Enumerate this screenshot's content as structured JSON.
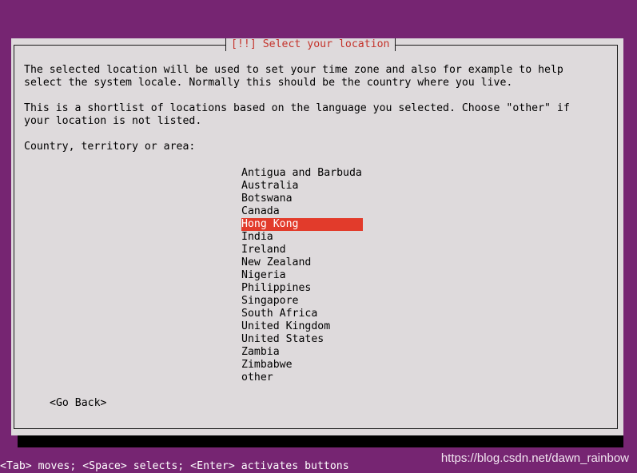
{
  "dialog": {
    "title": "[!!] Select your location",
    "paragraph1_line1": "The selected location will be used to set your time zone and also for example to help",
    "paragraph1_line2": "select the system locale. Normally this should be the country where you live.",
    "paragraph2_line1": "This is a shortlist of locations based on the language you selected. Choose \"other\" if",
    "paragraph2_line2": "your location is not listed.",
    "prompt": "Country, territory or area:",
    "countries": [
      "Antigua and Barbuda",
      "Australia",
      "Botswana",
      "Canada",
      "Hong Kong",
      "India",
      "Ireland",
      "New Zealand",
      "Nigeria",
      "Philippines",
      "Singapore",
      "South Africa",
      "United Kingdom",
      "United States",
      "Zambia",
      "Zimbabwe",
      "other"
    ],
    "selected_country": "Hong Kong",
    "go_back_label": "<Go Back>"
  },
  "footer": {
    "help": "<Tab> moves; <Space> selects; <Enter> activates buttons"
  },
  "watermark": "https://blog.csdn.net/dawn_rainbow",
  "colors": {
    "background": "#762572",
    "dialog": "#dedadc",
    "title_text": "#c4332b",
    "selection": "#e23b2b"
  }
}
